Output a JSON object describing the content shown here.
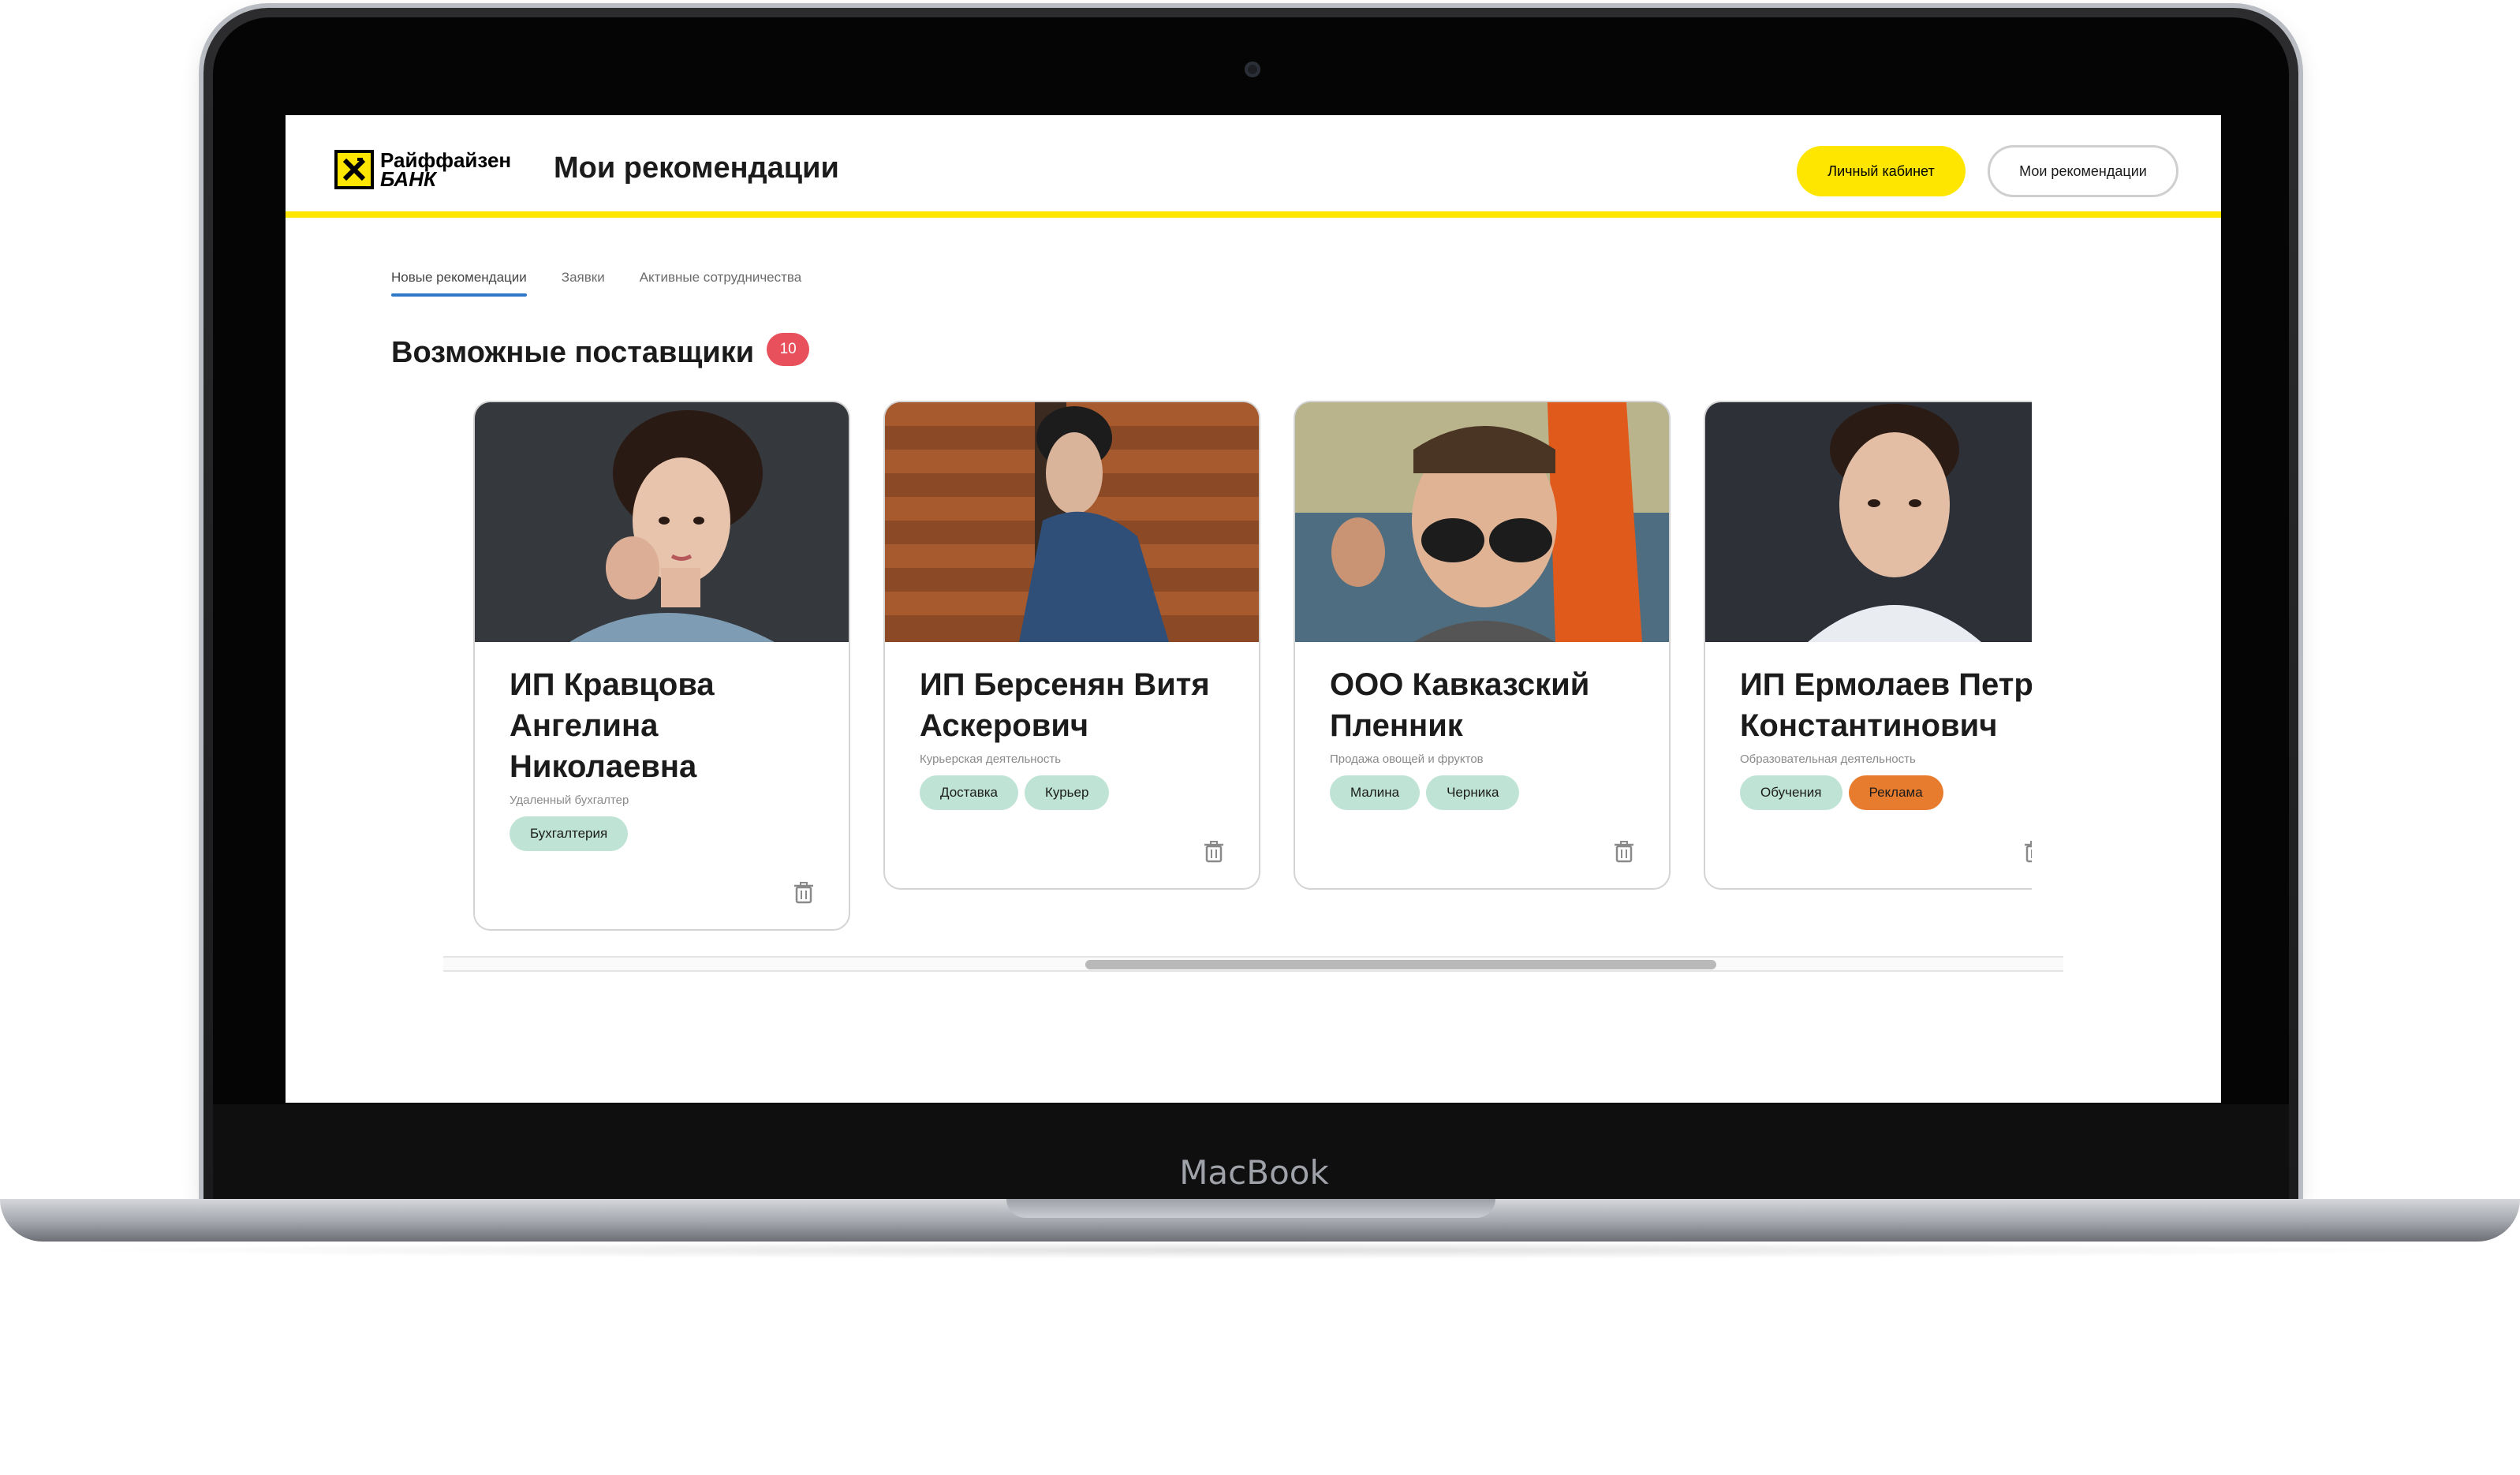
{
  "device": {
    "brand_label": "MacBook"
  },
  "header": {
    "logo_line1": "Райффайзен",
    "logo_line2": "БАНК",
    "title": "Мои рекомендации",
    "cabinet_button": "Личный кабинет",
    "recommendations_button": "Мои рекомендации",
    "accent_color": "#fee600"
  },
  "tabs": [
    {
      "label": "Новые рекомендации",
      "active": true
    },
    {
      "label": "Заявки",
      "active": false
    },
    {
      "label": "Активные сотрудничества",
      "active": false
    }
  ],
  "section": {
    "title": "Возможные поставщики",
    "count": "10"
  },
  "cards": [
    {
      "name": "ИП Кравцова Ангелина Николаевна",
      "subtitle": "Удаленный бухгалтер",
      "tags": [
        {
          "label": "Бухгалтерия"
        }
      ]
    },
    {
      "name": "ИП Берсенян Витя Аскерович",
      "subtitle": "Курьерская деятельность",
      "tags": [
        {
          "label": "Доставка"
        },
        {
          "label": "Курьер"
        }
      ]
    },
    {
      "name": "ООО Кавказский Пленник",
      "subtitle": "Продажа овощей и фруктов",
      "tags": [
        {
          "label": "Малина"
        },
        {
          "label": "Черника"
        }
      ]
    },
    {
      "name": "ИП Ермолаев Петр Константинович",
      "subtitle": "Образовательная деятельность",
      "tags": [
        {
          "label": "Обучения"
        },
        {
          "label": "Реклама",
          "color": "#e87c2e"
        }
      ]
    }
  ]
}
